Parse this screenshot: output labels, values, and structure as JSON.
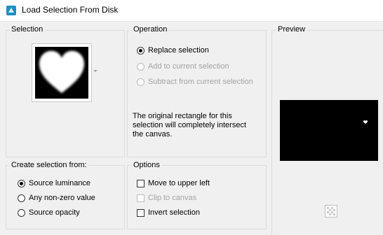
{
  "window": {
    "title": "Load Selection From Disk",
    "icon": "psp-app-icon"
  },
  "selection_group": {
    "label": "Selection",
    "thumbnail": "heart-shape-thumbnail",
    "dropdown_icon": "chevron-down-icon"
  },
  "operation_group": {
    "label": "Operation",
    "options": [
      {
        "label": "Replace selection",
        "checked": true,
        "enabled": true
      },
      {
        "label": "Add to current selection",
        "checked": false,
        "enabled": false
      },
      {
        "label": "Subtract from current selection",
        "checked": false,
        "enabled": false
      }
    ],
    "info_lines": [
      "The original rectangle for this",
      "selection will completely intersect",
      "the canvas."
    ]
  },
  "preview_group": {
    "label": "Preview",
    "toggle_icon": "checkerboard-icon"
  },
  "create_from_group": {
    "label": "Create selection from:",
    "options": [
      {
        "label": "Source luminance",
        "checked": true
      },
      {
        "label": "Any non-zero value",
        "checked": false
      },
      {
        "label": "Source opacity",
        "checked": false
      }
    ]
  },
  "options_group": {
    "label": "Options",
    "items": [
      {
        "label": "Move to upper left",
        "checked": false,
        "enabled": true
      },
      {
        "label": "Clip to canvas",
        "checked": false,
        "enabled": false
      },
      {
        "label": "Invert selection",
        "checked": false,
        "enabled": true
      }
    ]
  },
  "colors": {
    "icon_blue": "#1d8fc4",
    "dialog_bg": "#f0f0f0",
    "disabled_text": "#a3a3a3"
  }
}
